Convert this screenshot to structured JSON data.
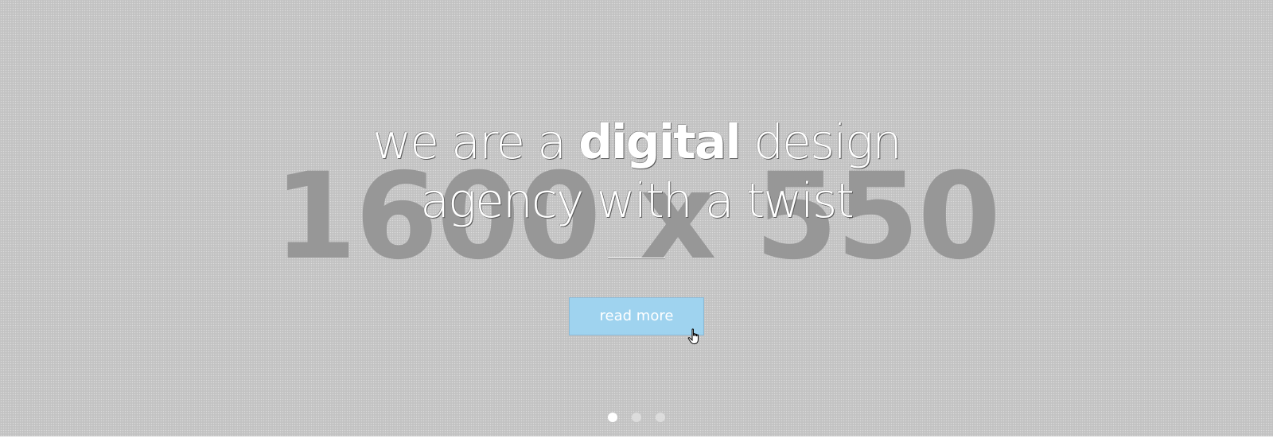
{
  "placeholder": {
    "size_text": "1600 x 550"
  },
  "hero": {
    "headline_part1": "we are a ",
    "headline_emphasis": "digital",
    "headline_part2": " design",
    "headline_line2": "agency with a twist",
    "cta_label": "read more"
  },
  "slider": {
    "slide_count": 3,
    "active_index": 0
  },
  "colors": {
    "background": "#c6c6c6",
    "placeholder_text": "#979797",
    "button": "#9fd3ef",
    "dot_active": "#ffffff",
    "dot_inactive": "#dcdcdc"
  },
  "icons": {
    "cursor": "hand-pointer-icon"
  }
}
